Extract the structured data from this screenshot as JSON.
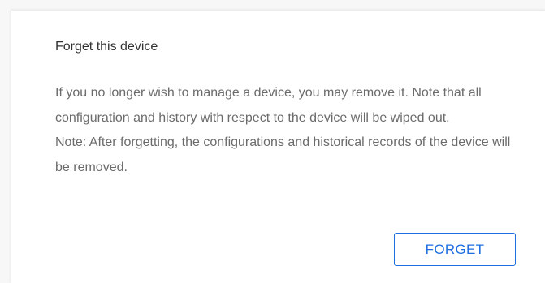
{
  "card": {
    "title": "Forget this device",
    "description": "If you no longer wish to manage a device, you may remove it. Note that all configuration and history with respect to the device will be wiped out.",
    "note": "Note: After forgetting, the configurations and historical records of the device will be removed.",
    "button_label": "FORGET"
  },
  "colors": {
    "accent": "#1d6ee0",
    "title_text": "#333333",
    "body_text": "#6b6b6b",
    "background": "#f7f7f7",
    "card_background": "#ffffff"
  }
}
